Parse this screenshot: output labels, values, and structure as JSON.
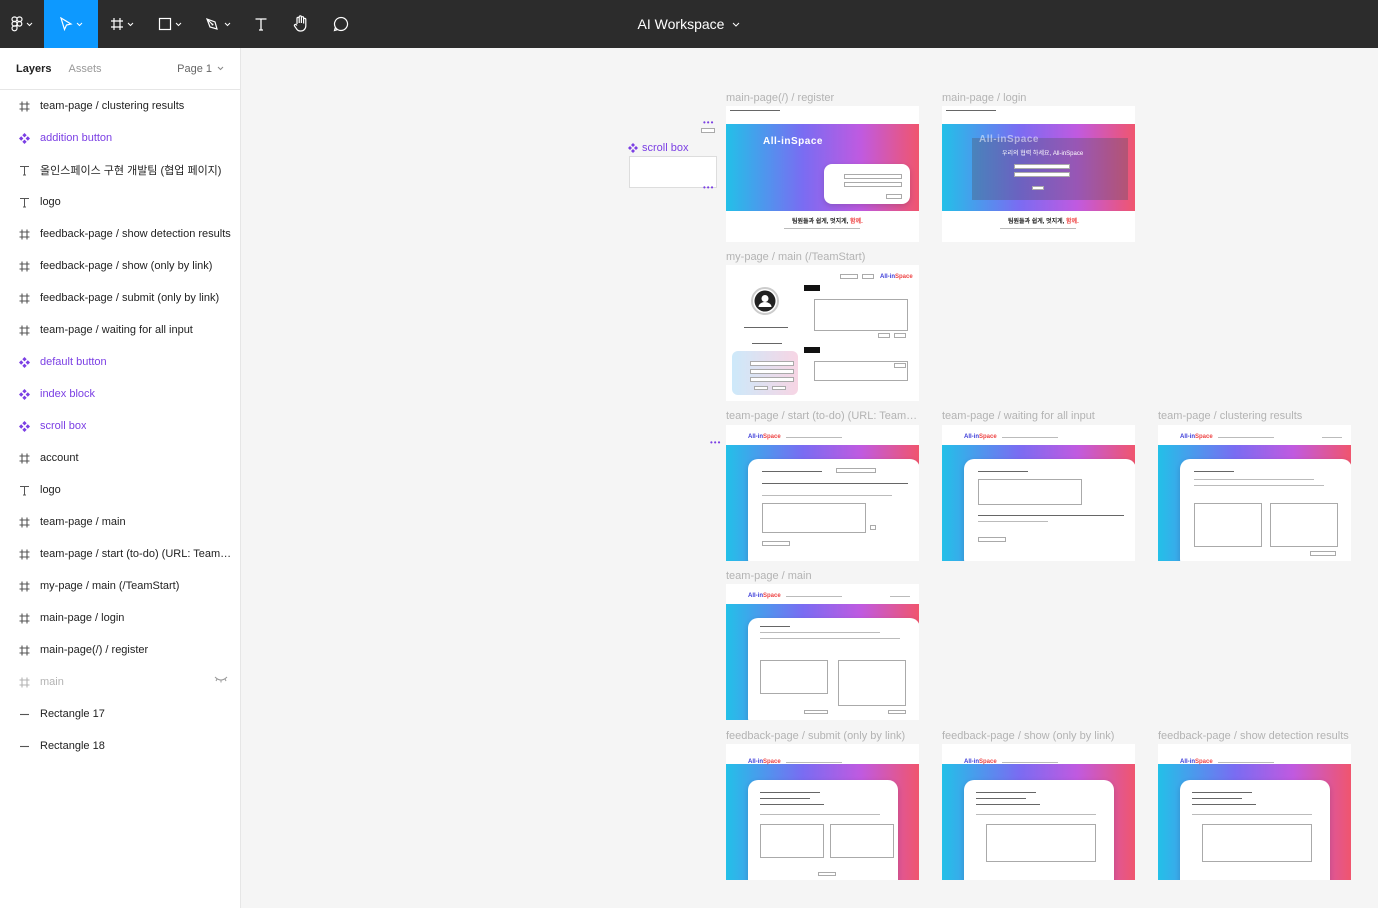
{
  "toolbar": {
    "tools": [
      "figma-menu",
      "move",
      "frame",
      "shape",
      "pen",
      "text",
      "hand",
      "comment"
    ],
    "title": "AI Workspace"
  },
  "sidebar": {
    "tab_layers": "Layers",
    "tab_assets": "Assets",
    "page": "Page 1",
    "layers": [
      {
        "type": "frame",
        "label": "team-page / clustering results"
      },
      {
        "type": "component",
        "label": "addition button"
      },
      {
        "type": "text",
        "label": "올인스페이스 구현 개발팀 (협업 페이지)"
      },
      {
        "type": "text",
        "label": "logo"
      },
      {
        "type": "frame",
        "label": "feedback-page / show detection results"
      },
      {
        "type": "frame",
        "label": "feedback-page / show (only by link)"
      },
      {
        "type": "frame",
        "label": "feedback-page / submit (only by link)"
      },
      {
        "type": "frame",
        "label": "team-page / waiting for all input"
      },
      {
        "type": "component",
        "label": "default button"
      },
      {
        "type": "component",
        "label": "index block"
      },
      {
        "type": "component",
        "label": "scroll box"
      },
      {
        "type": "frame",
        "label": "account"
      },
      {
        "type": "text",
        "label": "logo"
      },
      {
        "type": "frame",
        "label": "team-page / main"
      },
      {
        "type": "frame",
        "label": "team-page / start (to-do) (URL: TeamStart)"
      },
      {
        "type": "frame",
        "label": "my-page / main (/TeamStart)"
      },
      {
        "type": "frame",
        "label": "main-page / login"
      },
      {
        "type": "frame",
        "label": "main-page(/) / register"
      },
      {
        "type": "hidden",
        "label": "main"
      },
      {
        "type": "line",
        "label": "Rectangle 17"
      },
      {
        "type": "line",
        "label": "Rectangle 18"
      }
    ]
  },
  "canvas": {
    "scroll_box_label": "scroll box",
    "frames": {
      "register": "main-page(/) / register",
      "login": "main-page / login",
      "mypage": "my-page / main (/TeamStart)",
      "start": "team-page / start (to-do) (URL: TeamStart)",
      "waiting": "team-page / waiting for all input",
      "clustering": "team-page / clustering results",
      "teammain": "team-page / main",
      "submit": "feedback-page / submit (only by link)",
      "show": "feedback-page / show (only by link)",
      "detection": "feedback-page / show detection results"
    },
    "brand": "All-inSpace",
    "slogan_a": "팀원들과 쉽게, 멋지게,",
    "slogan_b": "함께.",
    "login_title": "Login Now",
    "login_tagline": "우리의 협력 하세요, All-inSpace"
  },
  "colors": {
    "toolbar_bg": "#2c2c2c",
    "active_tool": "#0d99ff",
    "component": "#7b3fe4"
  }
}
